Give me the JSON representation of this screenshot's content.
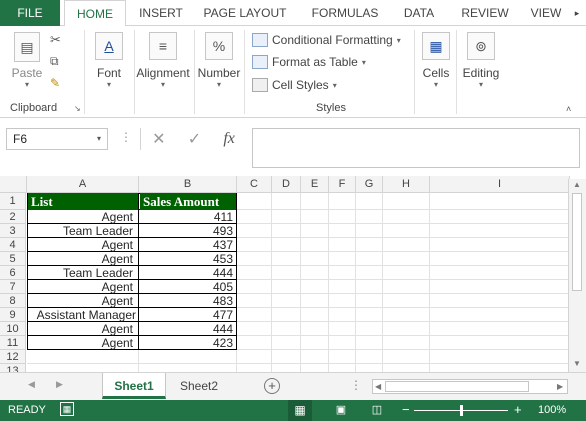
{
  "ribbon_tabs": [
    {
      "label": "FILE"
    },
    {
      "label": "HOME"
    },
    {
      "label": "INSERT"
    },
    {
      "label": "PAGE LAYOUT"
    },
    {
      "label": "FORMULAS"
    },
    {
      "label": "DATA"
    },
    {
      "label": "REVIEW"
    },
    {
      "label": "VIEW"
    }
  ],
  "ribbon": {
    "clipboard": {
      "paste": "Paste",
      "group": "Clipboard"
    },
    "font": {
      "label": "Font"
    },
    "alignment": {
      "label": "Alignment"
    },
    "number": {
      "label": "Number",
      "icon": "%"
    },
    "styles": {
      "conditional": "Conditional Formatting",
      "format_table": "Format as Table",
      "cell_styles": "Cell Styles",
      "group": "Styles"
    },
    "cells": {
      "label": "Cells"
    },
    "editing": {
      "label": "Editing"
    }
  },
  "formula_bar": {
    "name_box": "F6",
    "fx": "fx",
    "formula": ""
  },
  "columns": [
    "A",
    "B",
    "C",
    "D",
    "E",
    "F",
    "G",
    "H",
    "I"
  ],
  "rows": [
    "1",
    "2",
    "3",
    "4",
    "5",
    "6",
    "7",
    "8",
    "9",
    "10",
    "11",
    "12",
    "13"
  ],
  "table": {
    "headers": [
      "List",
      "Sales Amount"
    ],
    "rows": [
      [
        "Agent",
        "411"
      ],
      [
        "Team Leader",
        "493"
      ],
      [
        "Agent",
        "437"
      ],
      [
        "Agent",
        "453"
      ],
      [
        "Team Leader",
        "444"
      ],
      [
        "Agent",
        "405"
      ],
      [
        "Agent",
        "483"
      ],
      [
        "Assistant Manager",
        "477"
      ],
      [
        "Agent",
        "444"
      ],
      [
        "Agent",
        "423"
      ]
    ]
  },
  "sheets": [
    {
      "label": "Sheet1",
      "active": true
    },
    {
      "label": "Sheet2",
      "active": false
    }
  ],
  "status": {
    "ready": "READY",
    "zoom": "100%"
  },
  "colors": {
    "excel_green": "#217346",
    "header_fill": "#006100"
  }
}
